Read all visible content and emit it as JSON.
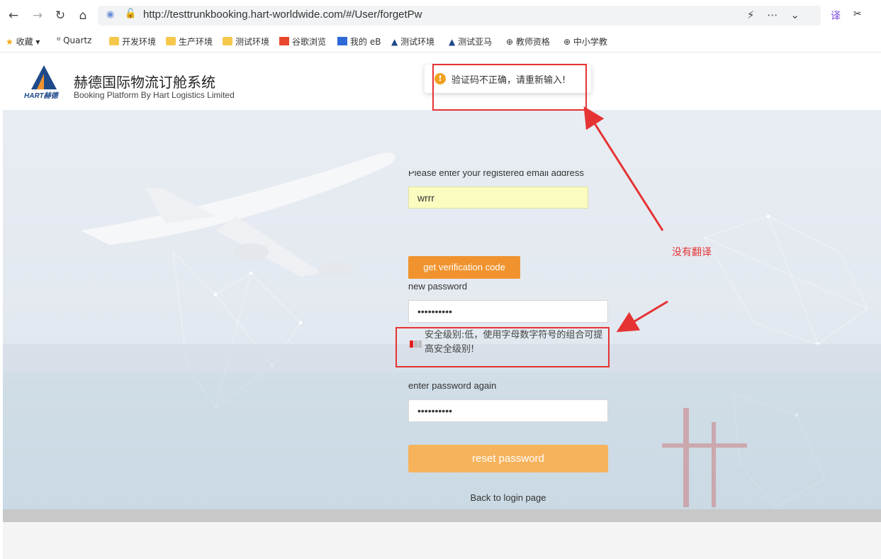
{
  "browser": {
    "url": "http://testtrunkbooking.hart-worldwide.com/#/User/forgetPw",
    "bookmarks": [
      "收藏",
      "Quartz",
      "开发环境",
      "生产环境",
      "测试环境",
      "谷歌浏览",
      "我的 eB",
      "测试环境",
      "测试亚马",
      "教师资格",
      "中小学教"
    ]
  },
  "header": {
    "logo_text": "HART赫德",
    "title_cn": "赫德国际物流订舱系统",
    "title_en": "Booking Platform By Hart Logistics Limited"
  },
  "toast": {
    "message": "验证码不正确，请重新输入!"
  },
  "form": {
    "email_label": "Please enter your registered email address",
    "email_value": "wrrr",
    "get_code_label": "get verification code",
    "new_password_label": "new password",
    "new_password_value": "••••••••••",
    "strength_text": "安全级别:低，使用字母数字符号的组合可提高安全级别!",
    "confirm_label": "enter password again",
    "confirm_value": "••••••••••",
    "reset_label": "reset password",
    "back_label": "Back to login page"
  },
  "annotation": {
    "note": "没有翻译"
  },
  "colors": {
    "accent": "#f0932e",
    "annotation": "#e53333",
    "toast_warning": "#f0a020"
  }
}
